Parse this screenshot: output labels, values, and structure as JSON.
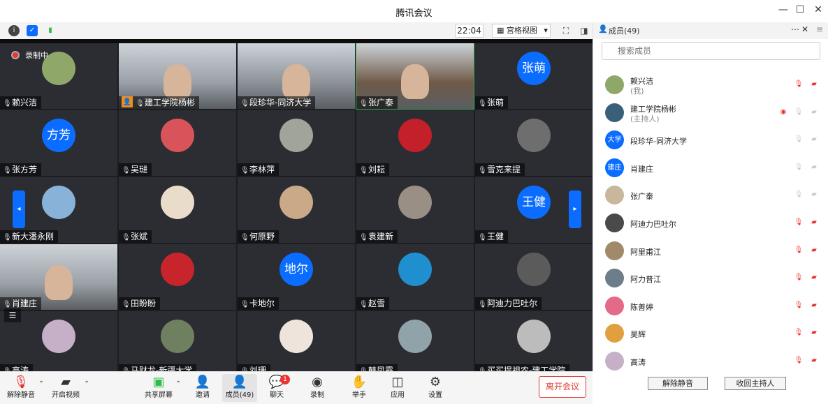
{
  "window": {
    "title": "腾讯会议",
    "minimize": "—",
    "maximize": "☐",
    "close": "✕"
  },
  "toolbar": {
    "time": "22:04",
    "view_label": "宫格视图",
    "view_chevron": "▾"
  },
  "recording": {
    "label": "录制中"
  },
  "grid": {
    "tiles": [
      {
        "name": "赖兴洁",
        "kind": "photo",
        "color": "#8fa86a"
      },
      {
        "name": "建工学院杨彬",
        "kind": "video",
        "color": "#9aa0a8",
        "host_flag": true
      },
      {
        "name": "段珍华-同济大学",
        "kind": "video",
        "color": "#8d9299"
      },
      {
        "name": "张广泰",
        "kind": "video",
        "color": "#6f5a48",
        "speaking": true
      },
      {
        "name": "张萌",
        "kind": "text",
        "avatar_text": "张萌"
      },
      {
        "name": "张方芳",
        "kind": "text",
        "avatar_text": "方芳"
      },
      {
        "name": "吴琎",
        "kind": "photo",
        "color": "#d8545a"
      },
      {
        "name": "李林萍",
        "kind": "photo",
        "color": "#a0a49a"
      },
      {
        "name": "刘耘",
        "kind": "photo",
        "color": "#c3202a"
      },
      {
        "name": "雪克来提",
        "kind": "photo",
        "color": "#6e6e6e"
      },
      {
        "name": "新大潘永刚",
        "kind": "photo",
        "color": "#89b2d8"
      },
      {
        "name": "张斌",
        "kind": "photo",
        "color": "#e9dccb"
      },
      {
        "name": "何原野",
        "kind": "photo",
        "color": "#c9a987"
      },
      {
        "name": "袁建新",
        "kind": "photo",
        "color": "#9a8f84"
      },
      {
        "name": "王健",
        "kind": "text",
        "avatar_text": "王健"
      },
      {
        "name": "肖建庄",
        "kind": "video",
        "color": "#9ba1a6"
      },
      {
        "name": "田盼盼",
        "kind": "photo",
        "color": "#c8242b"
      },
      {
        "name": "卡地尔",
        "kind": "text",
        "avatar_text": "地尔"
      },
      {
        "name": "赵雪",
        "kind": "photo",
        "color": "#1f8fcf"
      },
      {
        "name": "阿迪力巴吐尔",
        "kind": "photo",
        "color": "#5b5b5b"
      },
      {
        "name": "高涛",
        "kind": "photo",
        "color": "#c6b0c8"
      },
      {
        "name": "马财龙-新疆大学",
        "kind": "photo",
        "color": "#6f8060"
      },
      {
        "name": "刘珊",
        "kind": "photo",
        "color": "#efe4dc"
      },
      {
        "name": "韩凤霞",
        "kind": "photo",
        "color": "#8fa3a8"
      },
      {
        "name": "买买提祖农-建工学院",
        "kind": "photo",
        "color": "#bcbcbc"
      }
    ]
  },
  "members": {
    "title": "成员(49)",
    "more": "⋯",
    "close": "✕",
    "menu": "≡",
    "search_placeholder": "搜索成员",
    "items": [
      {
        "name": "赖兴洁",
        "sub": "(我)",
        "avatar_text": "",
        "avatar_color": "#8fa86a",
        "muted": true,
        "recording": false
      },
      {
        "name": "建工学院杨彬",
        "sub": "(主持人)",
        "avatar_text": "",
        "avatar_color": "#3a5f7a",
        "muted": false,
        "recording": true
      },
      {
        "name": "段珍华-同济大学",
        "sub": "",
        "avatar_text": "大学",
        "avatar_color": "#0b6dff",
        "muted": false,
        "recording": false
      },
      {
        "name": "肖建庄",
        "sub": "",
        "avatar_text": "建庄",
        "avatar_color": "#0b6dff",
        "muted": false,
        "recording": false
      },
      {
        "name": "张广泰",
        "sub": "",
        "avatar_text": "",
        "avatar_color": "#c8b79a",
        "muted": false,
        "recording": false
      },
      {
        "name": "阿迪力巴吐尔",
        "sub": "",
        "avatar_text": "",
        "avatar_color": "#4a4a4a",
        "muted": true,
        "recording": false
      },
      {
        "name": "阿里甫江",
        "sub": "",
        "avatar_text": "",
        "avatar_color": "#a08a6a",
        "muted": true,
        "recording": false
      },
      {
        "name": "阿力普江",
        "sub": "",
        "avatar_text": "",
        "avatar_color": "#6d7d8a",
        "muted": true,
        "recording": false
      },
      {
        "name": "陈善婷",
        "sub": "",
        "avatar_text": "",
        "avatar_color": "#e46a8a",
        "muted": true,
        "recording": false
      },
      {
        "name": "昊辉",
        "sub": "",
        "avatar_text": "",
        "avatar_color": "#e0a040",
        "muted": true,
        "recording": false
      },
      {
        "name": "高涛",
        "sub": "",
        "avatar_text": "",
        "avatar_color": "#c6b0c8",
        "muted": true,
        "recording": false
      }
    ],
    "unmute_all": "解除静音",
    "reclaim_host": "收回主持人"
  },
  "bottom": {
    "unmute": "解除静音",
    "start_video": "开启视频",
    "share": "共享屏幕",
    "invite": "邀请",
    "members": "成员(49)",
    "chat": "聊天",
    "chat_badge": "1",
    "record": "录制",
    "raise_hand": "举手",
    "apps": "应用",
    "settings": "设置",
    "leave": "离开会议"
  }
}
